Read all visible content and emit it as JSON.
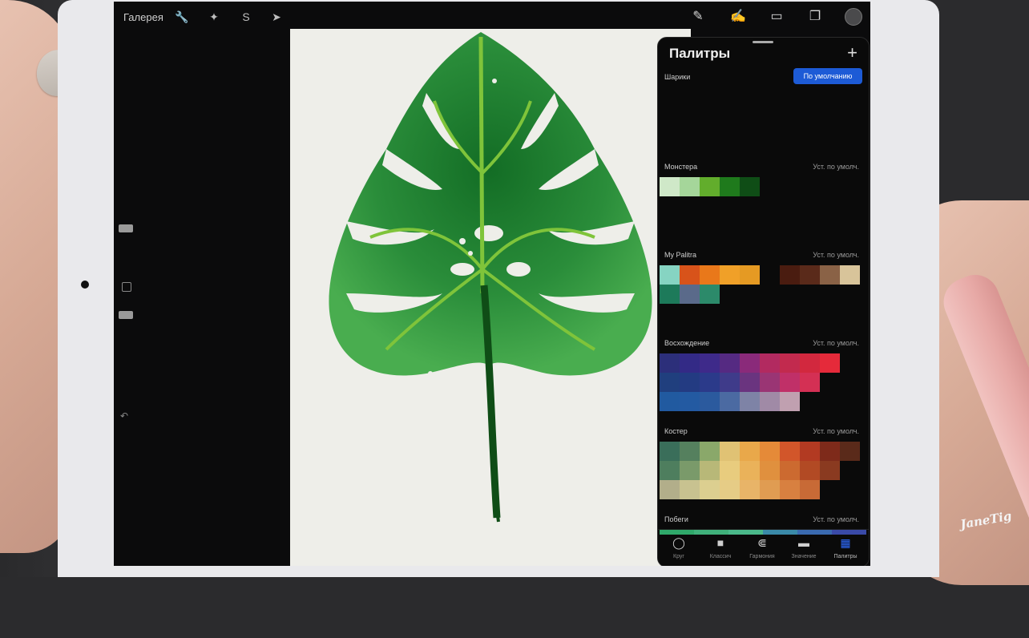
{
  "app": {
    "gallery_label": "Галерея"
  },
  "panel": {
    "title": "Палитры",
    "default_button": "По умолчанию",
    "palettes": [
      {
        "name": "Шарики",
        "default_label": "",
        "rows": []
      },
      {
        "name": "Монстера",
        "default_label": "Уст. по умолч.",
        "rows": [
          [
            "#cfe8c8",
            "#a5d69a",
            "#62ad2c",
            "#1f7a1c",
            "#0f4d16"
          ]
        ]
      },
      {
        "name": "My Palitra",
        "default_label": "Уст. по умолч.",
        "rows": [
          [
            "#86d4c2",
            "#d8531a",
            "#e9781a",
            "#f0a028",
            "#e59a23",
            "",
            "#4a1c10",
            "#5a2a1a",
            "#8a6246",
            "#d8c49a"
          ],
          [
            "#1d7a5a",
            "#5a6a8a",
            "#2c8a6a"
          ]
        ]
      },
      {
        "name": "Восхождение",
        "default_label": "Уст. по умолч.",
        "rows": [
          [
            "#2c2f7a",
            "#332a86",
            "#3e2a8a",
            "#552a82",
            "#8a2a7a",
            "#b22a60",
            "#c22a4e",
            "#d2283e",
            "#e52a3a"
          ],
          [
            "#203f7e",
            "#233b82",
            "#2b3a8a",
            "#3f3b8a",
            "#6a347f",
            "#9a3574",
            "#c03068",
            "#d43054"
          ],
          [
            "#215aa0",
            "#235aa2",
            "#2b5a9e",
            "#4b6aa2",
            "#7e83a6",
            "#a08aa6",
            "#c0a0b0"
          ]
        ]
      },
      {
        "name": "Костер",
        "default_label": "Уст. по умолч.",
        "rows": [
          [
            "#3a6e5a",
            "#55805e",
            "#8aa86a",
            "#e0c274",
            "#e9a84a",
            "#e58a38",
            "#d2562a",
            "#b23a22",
            "#7e2a1a",
            "#5a2a1a"
          ],
          [
            "#4e7e5e",
            "#7a9a6a",
            "#b8b878",
            "#e8cc7e",
            "#eab25a",
            "#e0903e",
            "#cc6a30",
            "#b24a24",
            "#8a3a20"
          ],
          [
            "#b2ae8a",
            "#c8c290",
            "#dccf90",
            "#e6cc86",
            "#e8b468",
            "#e09c52",
            "#d88040",
            "#c86a36"
          ]
        ]
      },
      {
        "name": "Побеги",
        "default_label": "Уст. по умолч.",
        "rows": [
          [
            "#2fa86a",
            "#3fb07a",
            "#4ab88a",
            "#3a8aa8",
            "#3a6ab0",
            "#3a4aa8"
          ]
        ]
      }
    ],
    "tabs": [
      {
        "label": "Круг",
        "icon": "circle-icon"
      },
      {
        "label": "Классич",
        "icon": "square-icon"
      },
      {
        "label": "Гармония",
        "icon": "harmony-icon"
      },
      {
        "label": "Значение",
        "icon": "sliders-icon"
      },
      {
        "label": "Палитры",
        "icon": "grid-icon",
        "active": true
      }
    ]
  },
  "watermark": "JaneTig"
}
